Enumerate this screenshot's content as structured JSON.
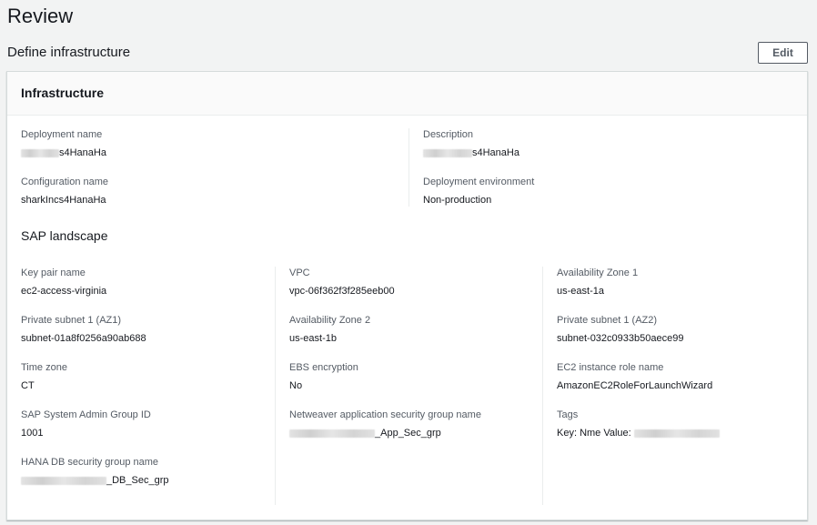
{
  "page": {
    "title": "Review"
  },
  "section": {
    "title": "Define infrastructure",
    "edit_label": "Edit"
  },
  "infrastructure": {
    "title": "Infrastructure",
    "deployment_name": {
      "label": "Deployment name",
      "value_suffix": "s4HanaHa"
    },
    "description": {
      "label": "Description",
      "value_suffix": "s4HanaHa"
    },
    "configuration_name": {
      "label": "Configuration name",
      "value": "sharkIncs4HanaHa"
    },
    "deployment_environment": {
      "label": "Deployment environment",
      "value": "Non-production"
    }
  },
  "sap_landscape": {
    "title": "SAP landscape",
    "key_pair_name": {
      "label": "Key pair name",
      "value": "ec2-access-virginia"
    },
    "vpc": {
      "label": "VPC",
      "value": "vpc-06f362f3f285eeb00"
    },
    "availability_zone_1": {
      "label": "Availability Zone 1",
      "value": "us-east-1a"
    },
    "private_subnet_az1": {
      "label": "Private subnet 1 (AZ1)",
      "value": "subnet-01a8f0256a90ab688"
    },
    "availability_zone_2": {
      "label": "Availability Zone 2",
      "value": "us-east-1b"
    },
    "private_subnet_az2": {
      "label": "Private subnet 1 (AZ2)",
      "value": "subnet-032c0933b50aece99"
    },
    "time_zone": {
      "label": "Time zone",
      "value": "CT"
    },
    "ebs_encryption": {
      "label": "EBS encryption",
      "value": "No"
    },
    "ec2_instance_role": {
      "label": "EC2 instance role name",
      "value": "AmazonEC2RoleForLaunchWizard"
    },
    "sap_admin_group": {
      "label": "SAP System Admin Group ID",
      "value": "1001"
    },
    "netweaver_sg": {
      "label": "Netweaver application security group name",
      "value_suffix": "_App_Sec_grp"
    },
    "tags": {
      "label": "Tags",
      "value_prefix": "Key: Nme Value:"
    },
    "hana_db_sg": {
      "label": "HANA DB security group name",
      "value_suffix": "_DB_Sec_grp"
    }
  }
}
